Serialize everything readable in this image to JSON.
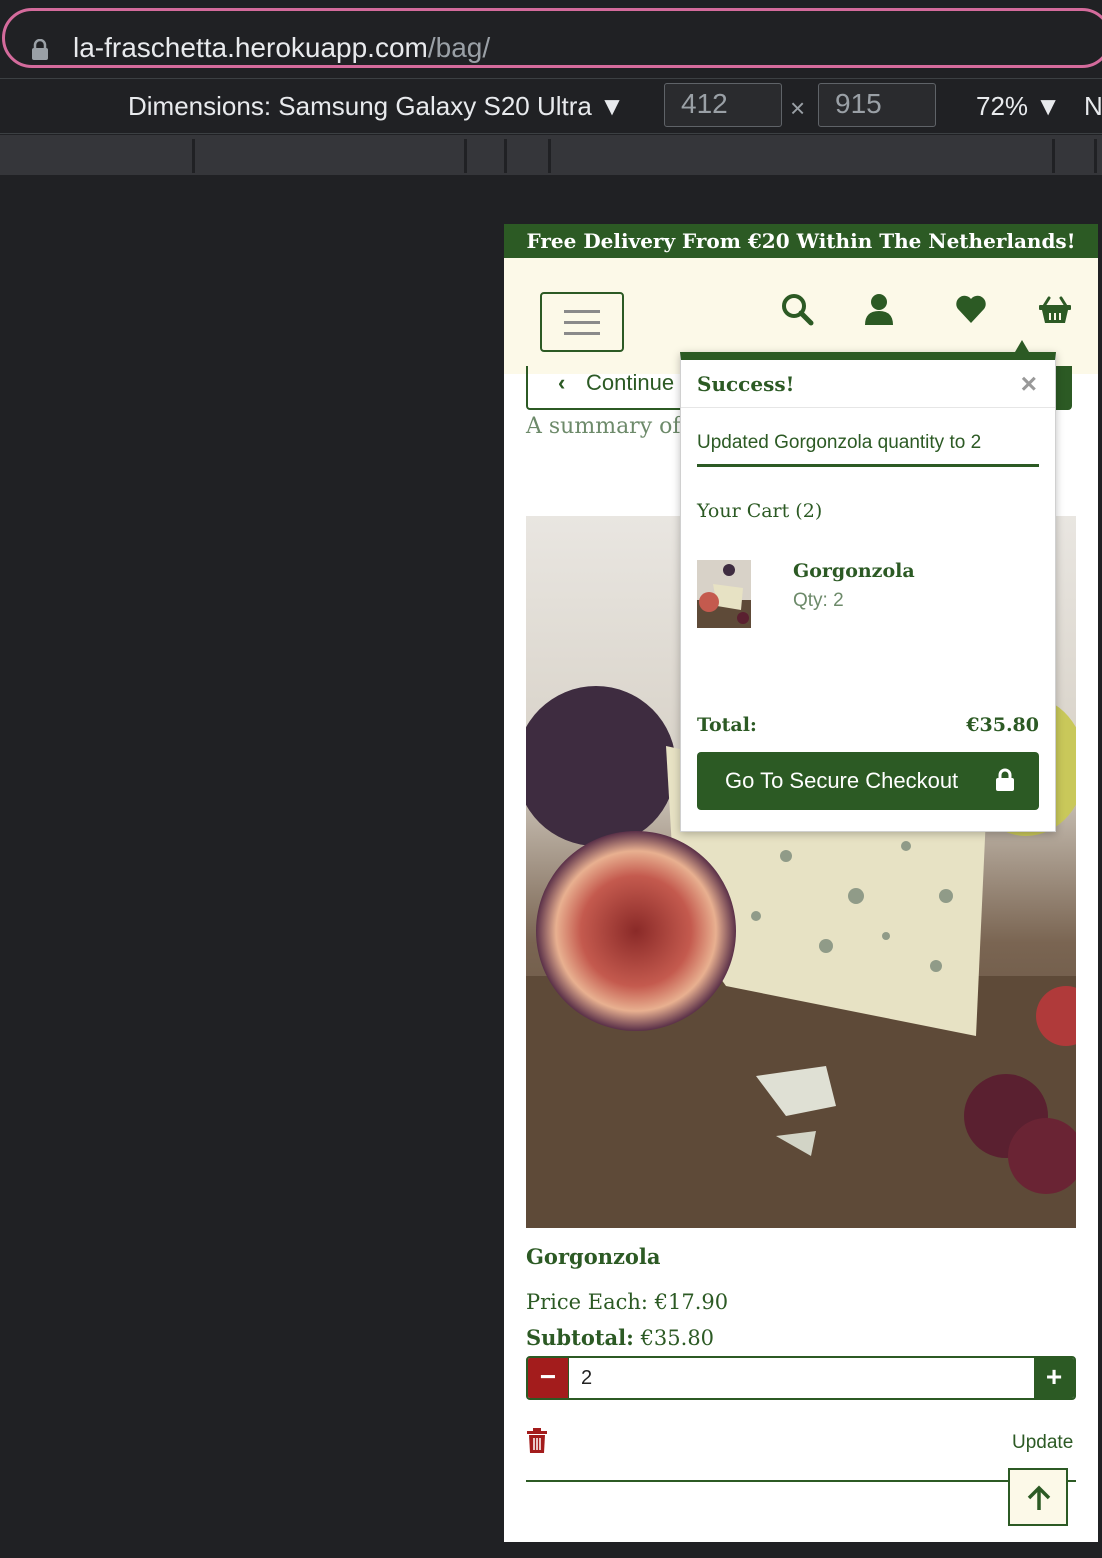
{
  "browser": {
    "url_host": "la-fraschetta.herokuapp.com",
    "url_path": "/bag/",
    "device_label": "Dimensions: Samsung Galaxy S20 Ultra ▼",
    "width": "412",
    "times": "×",
    "height": "915",
    "zoom": "72% ▼",
    "truncated": "N"
  },
  "site": {
    "promo": "Free Delivery From €20 Within The Netherlands!",
    "continue_label": "Continue",
    "continue_chevron": "‹",
    "summary": "A summary of"
  },
  "toast": {
    "title": "Success!",
    "close": "×",
    "message": "Updated Gorgonzola quantity to 2",
    "cart_label": "Your Cart (2)",
    "item_name": "Gorgonzola",
    "item_qty": "Qty: 2",
    "total_label": "Total:",
    "total_value": "€35.80",
    "checkout_label": "Go To Secure Checkout"
  },
  "product": {
    "name": "Gorgonzola",
    "price_each": "Price Each: €17.90",
    "subtotal_label": "Subtotal:",
    "subtotal_value": "€35.80",
    "minus": "−",
    "quantity": "2",
    "plus": "+",
    "update_label": "Update"
  },
  "colors": {
    "brand_green": "#2c5a24",
    "header_cream": "#fcf9e8",
    "remove_red": "#a31c1c",
    "url_outline": "#d46b9c"
  },
  "icons": [
    "lock-icon",
    "search-icon",
    "user-icon",
    "heart-icon",
    "basket-icon",
    "hamburger-icon",
    "trash-icon",
    "arrow-up-icon",
    "close-icon"
  ]
}
